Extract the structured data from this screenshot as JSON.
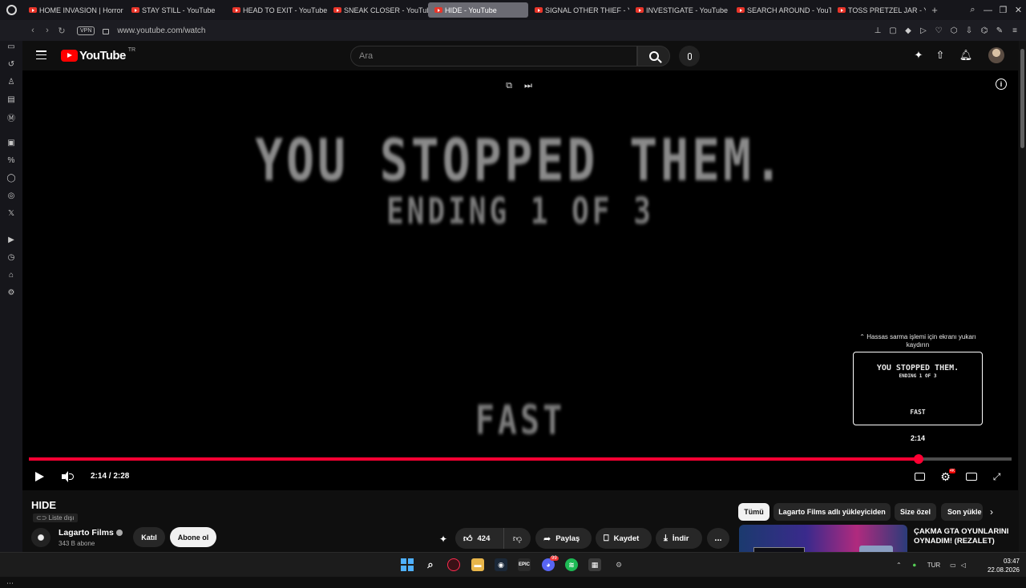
{
  "browser": {
    "tabs": [
      {
        "label": "HOME INVASION | Horror",
        "active": false
      },
      {
        "label": "STAY STILL - YouTube",
        "active": false
      },
      {
        "label": "HEAD TO EXIT - YouTube",
        "active": false
      },
      {
        "label": "SNEAK CLOSER - YouTube",
        "active": false
      },
      {
        "label": "HIDE - YouTube",
        "active": true
      },
      {
        "label": "SIGNAL OTHER THIEF - Yo",
        "active": false
      },
      {
        "label": "INVESTIGATE - YouTube",
        "active": false
      },
      {
        "label": "SEARCH AROUND - YouTu",
        "active": false
      },
      {
        "label": "TOSS PRETZEL JAR - You",
        "active": false
      }
    ],
    "new_tab": "+",
    "vpn_label": "VPN",
    "url": "www.youtube.com/watch"
  },
  "youtube": {
    "logo_text": "YouTube",
    "country_code": "TR",
    "search_placeholder": "Ara"
  },
  "player": {
    "overlay_line1": "YOU STOPPED THEM.",
    "overlay_line2": "ENDING 1 OF 3",
    "overlay_line3": "FAST",
    "seek_hint": "Hassas sarma işlemi için ekranı yukarı kaydırın",
    "preview_time": "2:14",
    "current_time": "2:14",
    "duration": "2:28",
    "time_display": "2:14 / 2:28",
    "progress_fraction": 0.9054,
    "settings_badge": "4K",
    "accent_color": "#ff0033"
  },
  "video": {
    "title": "HIDE",
    "visibility": "Liste dışı",
    "channel_name": "Lagarto Films",
    "subscriber_count": "343 B abone",
    "join_label": "Katıl",
    "subscribe_label": "Abone ol",
    "like_count": "424",
    "share_label": "Paylaş",
    "save_label": "Kaydet",
    "download_label": "İndir",
    "more_label": "..."
  },
  "recommendations": {
    "chips": [
      "Tümü",
      "Lagarto Films adlı yükleyiciden",
      "Size özel",
      "Son yükle"
    ],
    "first_title": "ÇAKMA GTA OYUNLARINI OYNADIM! (REZALET)"
  },
  "sidebar": {
    "gx_label": "GX"
  },
  "taskbar": {
    "language": "TUR",
    "time": "03:47",
    "date": "22.08.2026",
    "discord_badge": "99"
  }
}
